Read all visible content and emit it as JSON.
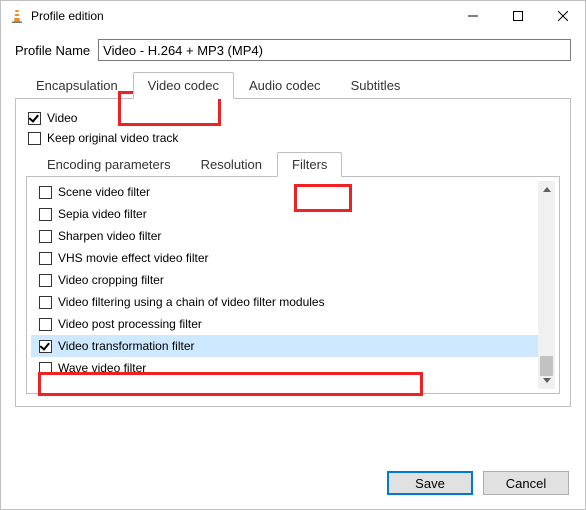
{
  "window": {
    "title": "Profile edition"
  },
  "profile": {
    "label": "Profile Name",
    "value": "Video - H.264 + MP3 (MP4)"
  },
  "tabs": {
    "encapsulation": "Encapsulation",
    "video": "Video codec",
    "audio": "Audio codec",
    "subtitles": "Subtitles"
  },
  "videoTab": {
    "videoChk": "Video",
    "keepOriginalChk": "Keep original video track",
    "subtabs": {
      "encoding": "Encoding parameters",
      "resolution": "Resolution",
      "filters": "Filters"
    },
    "filters": [
      {
        "label": "Scene video filter",
        "checked": false,
        "selected": false
      },
      {
        "label": "Sepia video filter",
        "checked": false,
        "selected": false
      },
      {
        "label": "Sharpen video filter",
        "checked": false,
        "selected": false
      },
      {
        "label": "VHS movie effect video filter",
        "checked": false,
        "selected": false
      },
      {
        "label": "Video cropping filter",
        "checked": false,
        "selected": false
      },
      {
        "label": "Video filtering using a chain of video filter modules",
        "checked": false,
        "selected": false
      },
      {
        "label": "Video post processing filter",
        "checked": false,
        "selected": false
      },
      {
        "label": "Video transformation filter",
        "checked": true,
        "selected": true
      },
      {
        "label": "Wave video filter",
        "checked": false,
        "selected": false
      }
    ]
  },
  "buttons": {
    "save": "Save",
    "cancel": "Cancel"
  }
}
